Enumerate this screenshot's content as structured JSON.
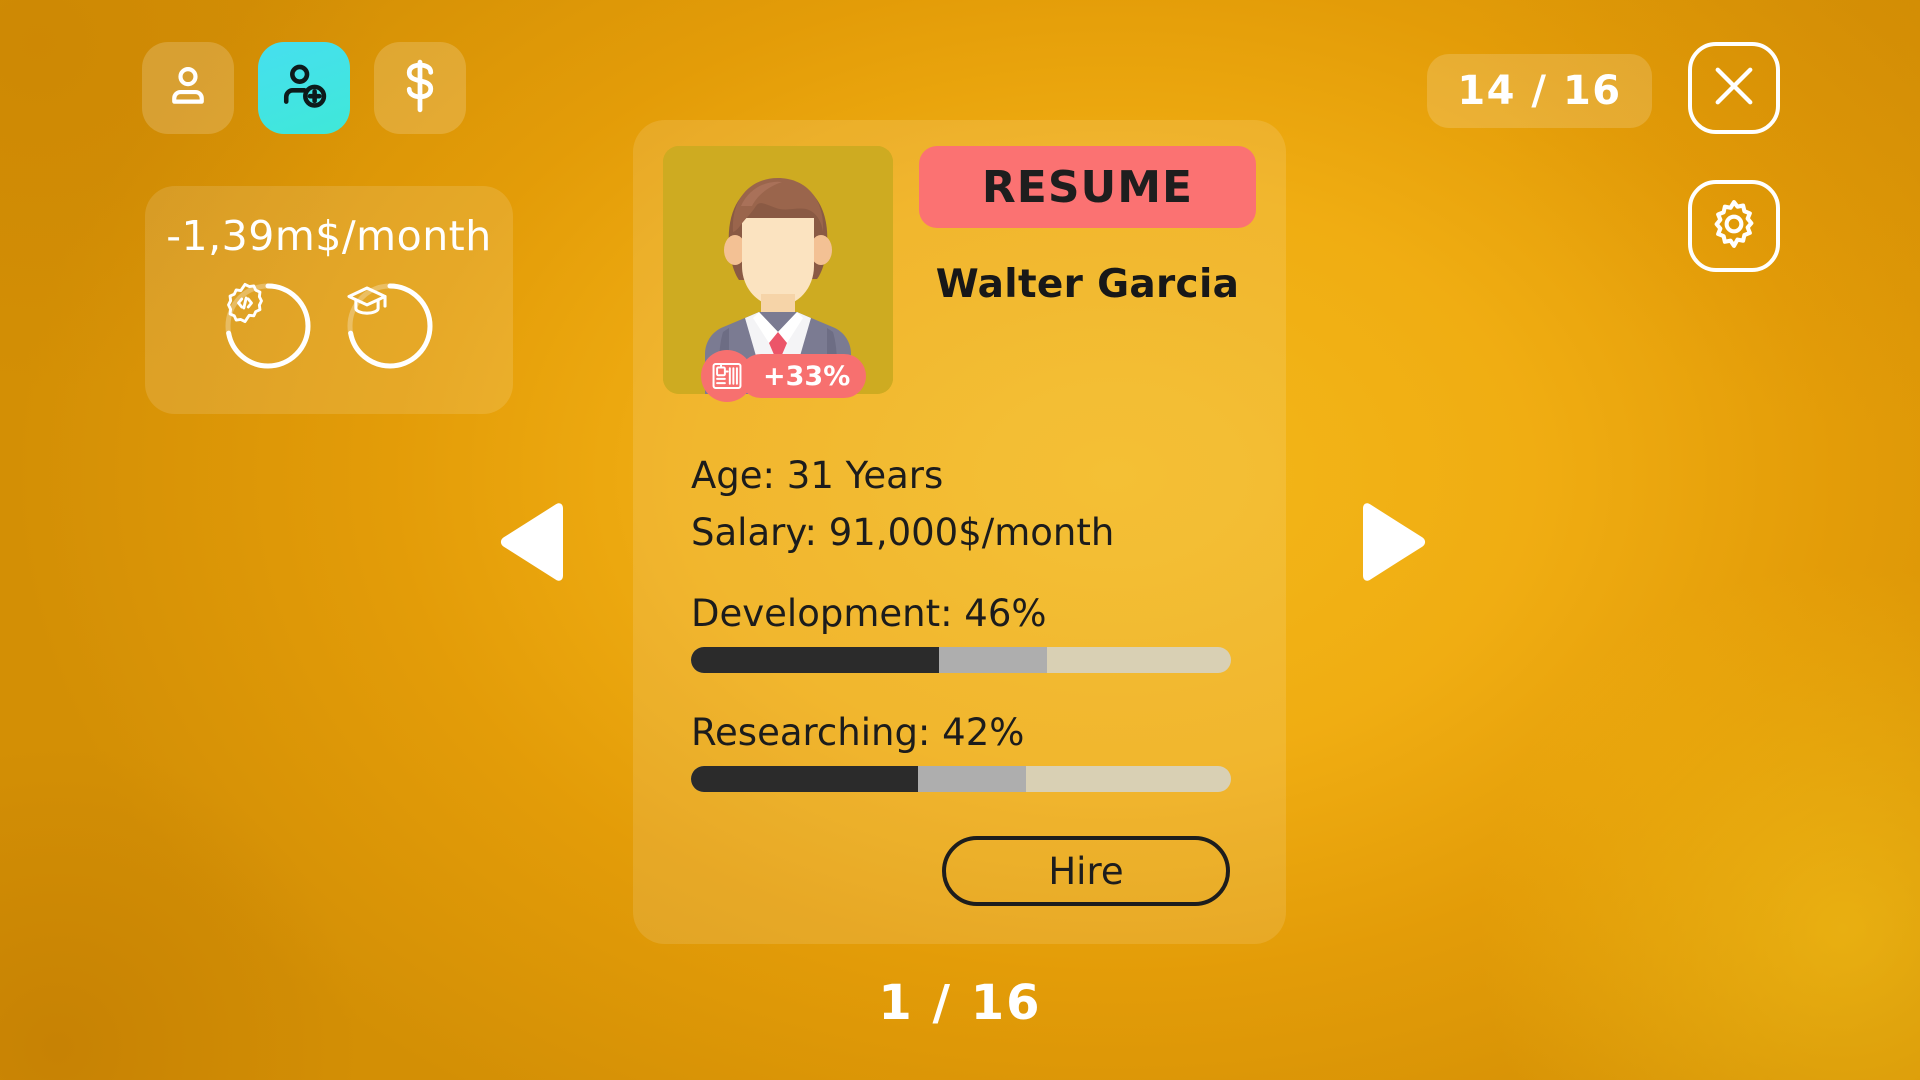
{
  "background": {
    "base_color": "#eeac12",
    "highlight_color": "#f6c61a",
    "shadow_color": "#c47c03"
  },
  "tabbar": {
    "tabs": [
      {
        "name": "employees",
        "icon": "person-icon",
        "active": false
      },
      {
        "name": "recruit",
        "icon": "person-add-icon",
        "active": true,
        "active_color": "#3fe0e0"
      },
      {
        "name": "finance",
        "icon": "dollar-icon",
        "active": false,
        "glyph": "$"
      }
    ]
  },
  "cost_panel": {
    "cost_text": "-1,39m$/month",
    "rings": [
      {
        "name": "development",
        "icon": "code-gear-icon",
        "progress_percent": 72
      },
      {
        "name": "research",
        "icon": "graduation-cap-icon",
        "progress_percent": 72
      }
    ]
  },
  "topbar": {
    "counter": "14 / 16",
    "close_label": "close-icon",
    "settings_label": "gear-icon"
  },
  "nav": {
    "prev": "previous-candidate",
    "next": "next-candidate"
  },
  "card": {
    "resume_label": "RESUME",
    "candidate_name": "Walter Garcia",
    "bonus_badge": "+33%",
    "bonus_icon": "circuit-board-icon",
    "age_line": "Age: 31 Years",
    "salary_line": "Salary: 91,000$/month",
    "skills": [
      {
        "label": "Development: 46%",
        "value": 46,
        "mid_extent": 66
      },
      {
        "label": "Researching: 42%",
        "value": 42,
        "mid_extent": 62
      }
    ],
    "hire_label": "Hire",
    "accent_color": "#fb7272"
  },
  "footer": {
    "page_indicator": "1 / 16"
  }
}
